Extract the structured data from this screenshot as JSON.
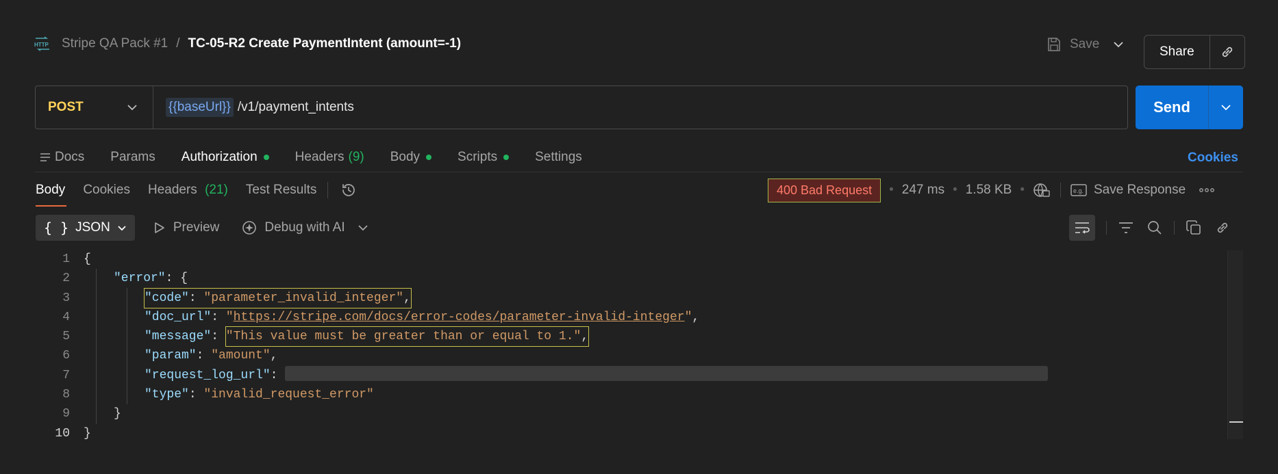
{
  "header": {
    "protocol_icon": "HTTP",
    "collection": "Stripe QA Pack #1",
    "separator": "/",
    "request_title": "TC-05-R2 Create PaymentIntent (amount=-1)",
    "save_label": "Save",
    "share_label": "Share"
  },
  "request": {
    "method": "POST",
    "url_variable": "{{baseUrl}}",
    "url_path": "/v1/payment_intents",
    "send_label": "Send"
  },
  "request_tabs": [
    {
      "label": "Docs"
    },
    {
      "label": "Params"
    },
    {
      "label": "Authorization",
      "dot": true
    },
    {
      "label": "Headers",
      "count": "(9)"
    },
    {
      "label": "Body",
      "dot": true
    },
    {
      "label": "Scripts",
      "dot": true
    },
    {
      "label": "Settings"
    }
  ],
  "cookies_link": "Cookies",
  "response_tabs": [
    {
      "label": "Body"
    },
    {
      "label": "Cookies"
    },
    {
      "label": "Headers",
      "count": "(21)"
    },
    {
      "label": "Test Results"
    }
  ],
  "response_meta": {
    "status": "400 Bad Request",
    "time": "247 ms",
    "size": "1.58 KB",
    "save_response": "Save Response"
  },
  "response_toolbar": {
    "format": "JSON",
    "preview": "Preview",
    "debug": "Debug with AI"
  },
  "code_lines": [
    "1",
    "2",
    "3",
    "4",
    "5",
    "6",
    "7",
    "8",
    "9",
    "10"
  ],
  "json_body": {
    "open_brace": "{",
    "error_key": "\"error\"",
    "code_key": "\"code\"",
    "code_val": "\"parameter_invalid_integer\"",
    "doc_url_key": "\"doc_url\"",
    "doc_url_val": "https://stripe.com/docs/error-codes/parameter-invalid-integer",
    "message_key": "\"message\"",
    "message_val": "\"This value must be greater than or equal to 1.\"",
    "param_key": "\"param\"",
    "param_val": "\"amount\"",
    "request_log_url_key": "\"request_log_url\"",
    "type_key": "\"type\"",
    "type_val": "\"invalid_request_error\"",
    "inner_close": "}",
    "close_brace": "}"
  },
  "colors": {
    "accent": "#0b6fd6",
    "method": "#ffd35a",
    "status_error": "#ff7b6a",
    "green_dot": "#21b35e"
  }
}
